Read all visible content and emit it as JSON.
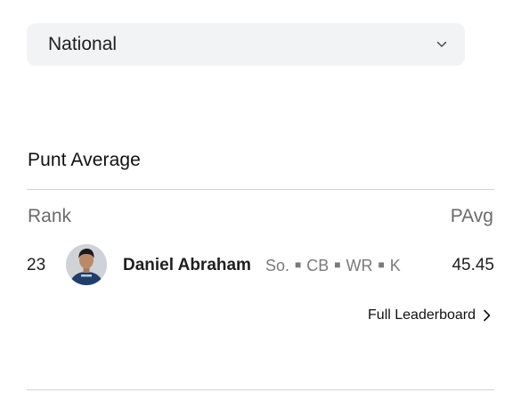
{
  "filter": {
    "selected": "National",
    "icon": "chevron-down-icon"
  },
  "leaderboard": {
    "title": "Punt Average",
    "columns": {
      "rank": "Rank",
      "stat": "PAvg"
    },
    "rows": [
      {
        "rank": "23",
        "name": "Daniel Abraham",
        "class_year": "So.",
        "positions": [
          "CB",
          "WR",
          "K"
        ],
        "value": "45.45"
      }
    ],
    "full_link_label": "Full Leaderboard",
    "link_icon": "chevron-right-icon"
  },
  "colors": {
    "select_bg": "#f2f3f5",
    "muted_text": "#6b6b6b",
    "divider": "#d4d4d4"
  }
}
